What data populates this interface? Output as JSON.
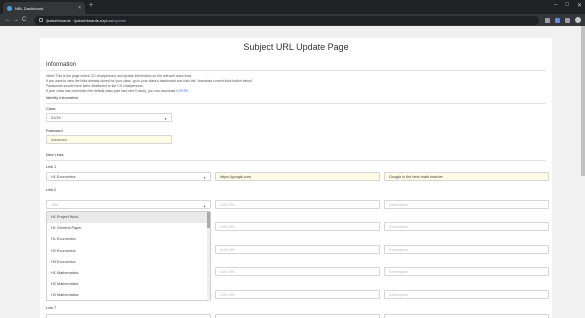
{
  "browser": {
    "tab_title": "NBL Dashboard",
    "tab_close": "×",
    "new_tab": "+",
    "url_host": "ljsdashboards · ljsdashboards.ezpl.co",
    "url_path": "/update",
    "back": "←",
    "forward": "→",
    "reload": "C",
    "min": "–",
    "max": "□",
    "close": "✕"
  },
  "page": {
    "title": "Subject URL Update Page",
    "information_heading": "Information",
    "intro_lines": [
      "Hello! This is the page where CG chairpersons can update information on the relevant class links.",
      "If you want to view the links already stored for your class, go to your class's dashboard and click the \"download current links button below\".",
      "Passwords should have been distributed to the CG chairpersons.",
      "If your class has overridden the default class (see last mint.9 hack), you can download "
    ],
    "intro_link": "it HERE.",
    "identity_heading": "Identity Information",
    "class_label": "Class",
    "class_value": "21/19",
    "password_label": "Password",
    "password_value": "••••••••••••",
    "new_links_heading": "New Links",
    "link1_label": "Link 1",
    "link1_subject": "H1 Economics",
    "link1_url": "https://google.com",
    "link1_desc": "Google is the best math teacher",
    "link2_label": "Link 2",
    "link2_subject_placeholder": "Title",
    "url_placeholder": "Link URL",
    "desc_placeholder": "Description",
    "link7_label": "Link 7",
    "dropdown_options": [
      "H1 Project Work",
      "H1 General Paper",
      "H1 Economics",
      "H2 Economics",
      "H3 Economics",
      "H1 Mathematics",
      "H2 Mathematics",
      "H3 Mathematics"
    ]
  }
}
